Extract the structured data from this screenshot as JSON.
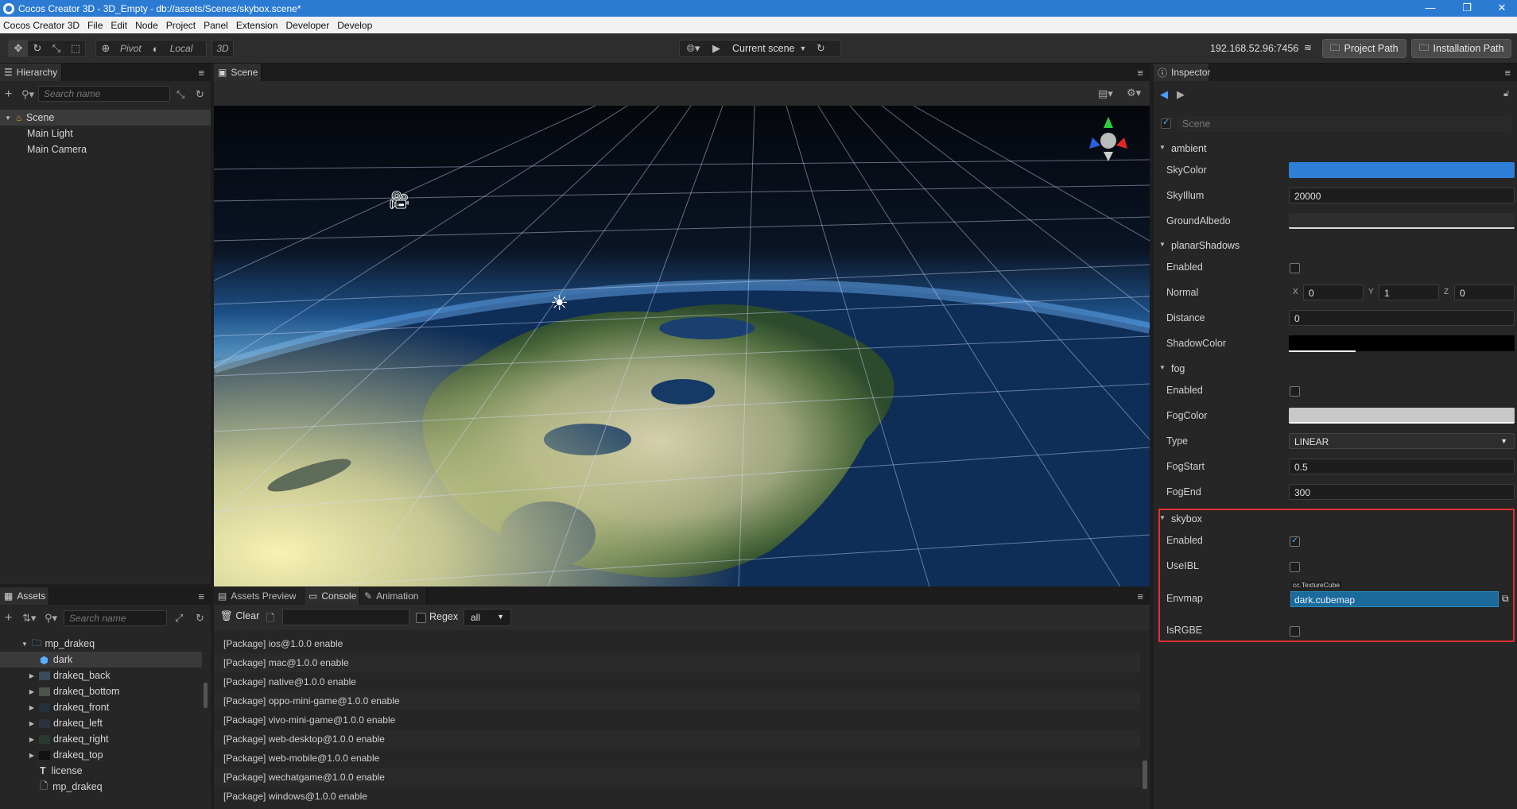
{
  "window": {
    "title": "Cocos Creator 3D - 3D_Empty - db://assets/Scenes/skybox.scene*",
    "minimize": "—",
    "maximize": "❐",
    "close": "✕"
  },
  "menu": [
    "Cocos Creator 3D",
    "File",
    "Edit",
    "Node",
    "Project",
    "Panel",
    "Extension",
    "Developer",
    "Develop"
  ],
  "toolbar": {
    "pivot": "Pivot",
    "local": "Local",
    "mode3d": "3D",
    "scene_select": "Current scene",
    "ip": "192.168.52.96:7456",
    "project_path": "Project Path",
    "install_path": "Installation Path"
  },
  "hierarchy": {
    "tab": "Hierarchy",
    "search_placeholder": "Search name",
    "root": "Scene",
    "children": [
      "Main Light",
      "Main Camera"
    ]
  },
  "scene_panel": {
    "tab": "Scene"
  },
  "assets": {
    "tab": "Assets",
    "search_placeholder": "Search name",
    "folder": "mp_drakeq",
    "items": [
      {
        "name": "dark",
        "icon": "cube-icon",
        "selected": true,
        "expandable": false
      },
      {
        "name": "drakeq_back",
        "icon": "image-icon",
        "expandable": true
      },
      {
        "name": "drakeq_bottom",
        "icon": "image-icon",
        "expandable": true
      },
      {
        "name": "drakeq_front",
        "icon": "image-icon",
        "expandable": true
      },
      {
        "name": "drakeq_left",
        "icon": "image-icon",
        "expandable": true
      },
      {
        "name": "drakeq_right",
        "icon": "image-icon",
        "expandable": true
      },
      {
        "name": "drakeq_top",
        "icon": "image-icon",
        "expandable": true
      },
      {
        "name": "license",
        "icon": "text-icon",
        "expandable": false
      },
      {
        "name": "mp_drakeq",
        "icon": "file-icon",
        "expandable": false
      }
    ]
  },
  "bottom_tabs": [
    "Assets Preview",
    "Console",
    "Animation"
  ],
  "console": {
    "clear": "Clear",
    "regex": "Regex",
    "filter": "all",
    "logs": [
      "[Package] ios@1.0.0 enable",
      "[Package] mac@1.0.0 enable",
      "[Package] native@1.0.0 enable",
      "[Package] oppo-mini-game@1.0.0 enable",
      "[Package] vivo-mini-game@1.0.0 enable",
      "[Package] web-desktop@1.0.0 enable",
      "[Package] web-mobile@1.0.0 enable",
      "[Package] wechatgame@1.0.0 enable",
      "[Package] windows@1.0.0 enable"
    ]
  },
  "inspector": {
    "tab": "Inspector",
    "node_name": "Scene",
    "ambient": {
      "title": "ambient",
      "sky_color_label": "SkyColor",
      "sky_color": "#2f7ed8",
      "sky_illum_label": "SkyIllum",
      "sky_illum": "20000",
      "ground_albedo_label": "GroundAlbedo",
      "ground_albedo": "#2e2e2e"
    },
    "planar_shadows": {
      "title": "planarShadows",
      "enabled_label": "Enabled",
      "normal_label": "Normal",
      "normal": {
        "x": "0",
        "y": "1",
        "z": "0"
      },
      "axis_x": "X",
      "axis_y": "Y",
      "axis_z": "Z",
      "distance_label": "Distance",
      "distance": "0",
      "shadow_color_label": "ShadowColor",
      "shadow_color": "#000000"
    },
    "fog": {
      "title": "fog",
      "enabled_label": "Enabled",
      "fog_color_label": "FogColor",
      "fog_color": "#c8c8c8",
      "type_label": "Type",
      "type": "LINEAR",
      "fog_start_label": "FogStart",
      "fog_start": "0.5",
      "fog_end_label": "FogEnd",
      "fog_end": "300"
    },
    "skybox": {
      "title": "skybox",
      "enabled_label": "Enabled",
      "use_ibl_label": "UseIBL",
      "envmap_label": "Envmap",
      "envmap_type": "cc.TextureCube",
      "envmap": "dark.cubemap",
      "is_rgbe_label": "IsRGBE",
      "highlight": "#e03030"
    }
  }
}
